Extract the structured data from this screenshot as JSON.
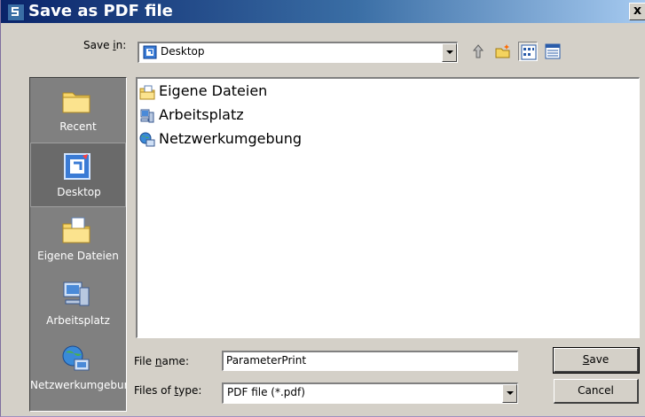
{
  "window": {
    "title": "Save as PDF file",
    "close_label": "x"
  },
  "toolbar": {
    "save_in_label_pre": "Save ",
    "save_in_label_accel": "i",
    "save_in_label_post": "n:",
    "save_in_value": "Desktop",
    "buttons": [
      {
        "name": "up-one-level-icon"
      },
      {
        "name": "create-new-folder-icon"
      },
      {
        "name": "list-view-icon"
      },
      {
        "name": "details-view-icon"
      }
    ]
  },
  "places": [
    {
      "label": "Recent",
      "icon": "folder-icon"
    },
    {
      "label": "Desktop",
      "icon": "desktop-icon"
    },
    {
      "label": "Eigene Dateien",
      "icon": "my-documents-icon"
    },
    {
      "label": "Arbeitsplatz",
      "icon": "my-computer-icon"
    },
    {
      "label": "Netzwerkumgebung",
      "icon": "network-icon"
    }
  ],
  "files": [
    {
      "name": "Eigene Dateien",
      "icon": "my-documents-icon"
    },
    {
      "name": "Arbeitsplatz",
      "icon": "my-computer-icon"
    },
    {
      "name": "Netzwerkumgebung",
      "icon": "network-icon"
    }
  ],
  "form": {
    "file_name_label_pre": "File ",
    "file_name_label_accel": "n",
    "file_name_label_post": "ame:",
    "file_name_value": "ParameterPrint",
    "file_type_label_pre": "Files of ",
    "file_type_label_accel": "t",
    "file_type_label_post": "ype:",
    "file_type_value": "PDF file (*.pdf)",
    "save_label_accel": "S",
    "save_label_post": "ave",
    "cancel_label": "Cancel"
  }
}
